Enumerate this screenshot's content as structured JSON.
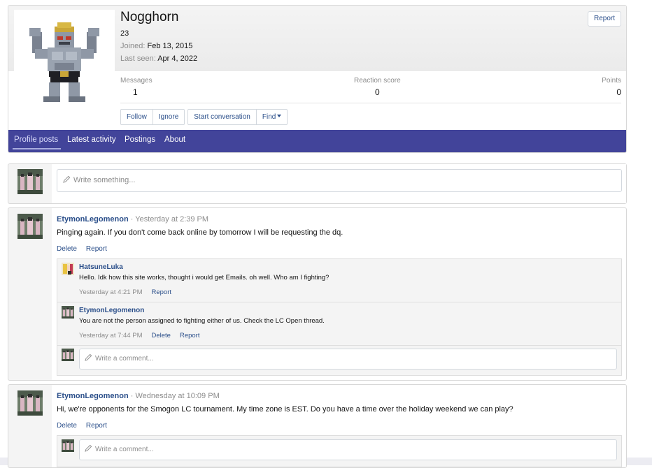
{
  "profile": {
    "username": "Nogghorn",
    "custom_title": "23",
    "joined_label": "Joined:",
    "joined_value": "Feb 13, 2015",
    "last_seen_label": "Last seen:",
    "last_seen_value": "Apr 4, 2022",
    "report_label": "Report",
    "stats": {
      "messages_label": "Messages",
      "messages_value": "1",
      "reaction_label": "Reaction score",
      "reaction_value": "0",
      "points_label": "Points",
      "points_value": "0"
    },
    "buttons": {
      "follow": "Follow",
      "ignore": "Ignore",
      "start_conversation": "Start conversation",
      "find": "Find"
    }
  },
  "tabs": [
    "Profile posts",
    "Latest activity",
    "Postings",
    "About"
  ],
  "active_tab": "Profile posts",
  "composer": {
    "placeholder": "Write something..."
  },
  "posts": [
    {
      "author": "EtymonLegomenon",
      "time": "Yesterday at 2:39 PM",
      "body": "Pinging again. If you don't come back online by tomorrow I will be requesting the dq.",
      "actions": [
        "Delete",
        "Report"
      ],
      "comments": [
        {
          "author": "HatsuneLuka",
          "body": "Hello. Idk how this site works, thought i would get Emails. oh well. Who am I fighting?",
          "time": "Yesterday at 4:21 PM",
          "actions": [
            "Report"
          ]
        },
        {
          "author": "EtymonLegomenon",
          "body": "You are not the person assigned to fighting either of us. Check the LC Open thread.",
          "time": "Yesterday at 7:44 PM",
          "actions": [
            "Delete",
            "Report"
          ]
        }
      ],
      "comment_placeholder": "Write a comment..."
    },
    {
      "author": "EtymonLegomenon",
      "time": "Wednesday at 10:09 PM",
      "body": "Hi, we're opponents for the Smogon LC tournament. My time zone is EST. Do you have a time over the holiday weekend we can play?",
      "actions": [
        "Delete",
        "Report"
      ],
      "comment_placeholder": "Write a comment..."
    }
  ],
  "colors": {
    "tab_bar": "#42449a",
    "link": "#2b4f8a",
    "muted": "#8c8c8c",
    "card_border": "#d8d8d8"
  }
}
